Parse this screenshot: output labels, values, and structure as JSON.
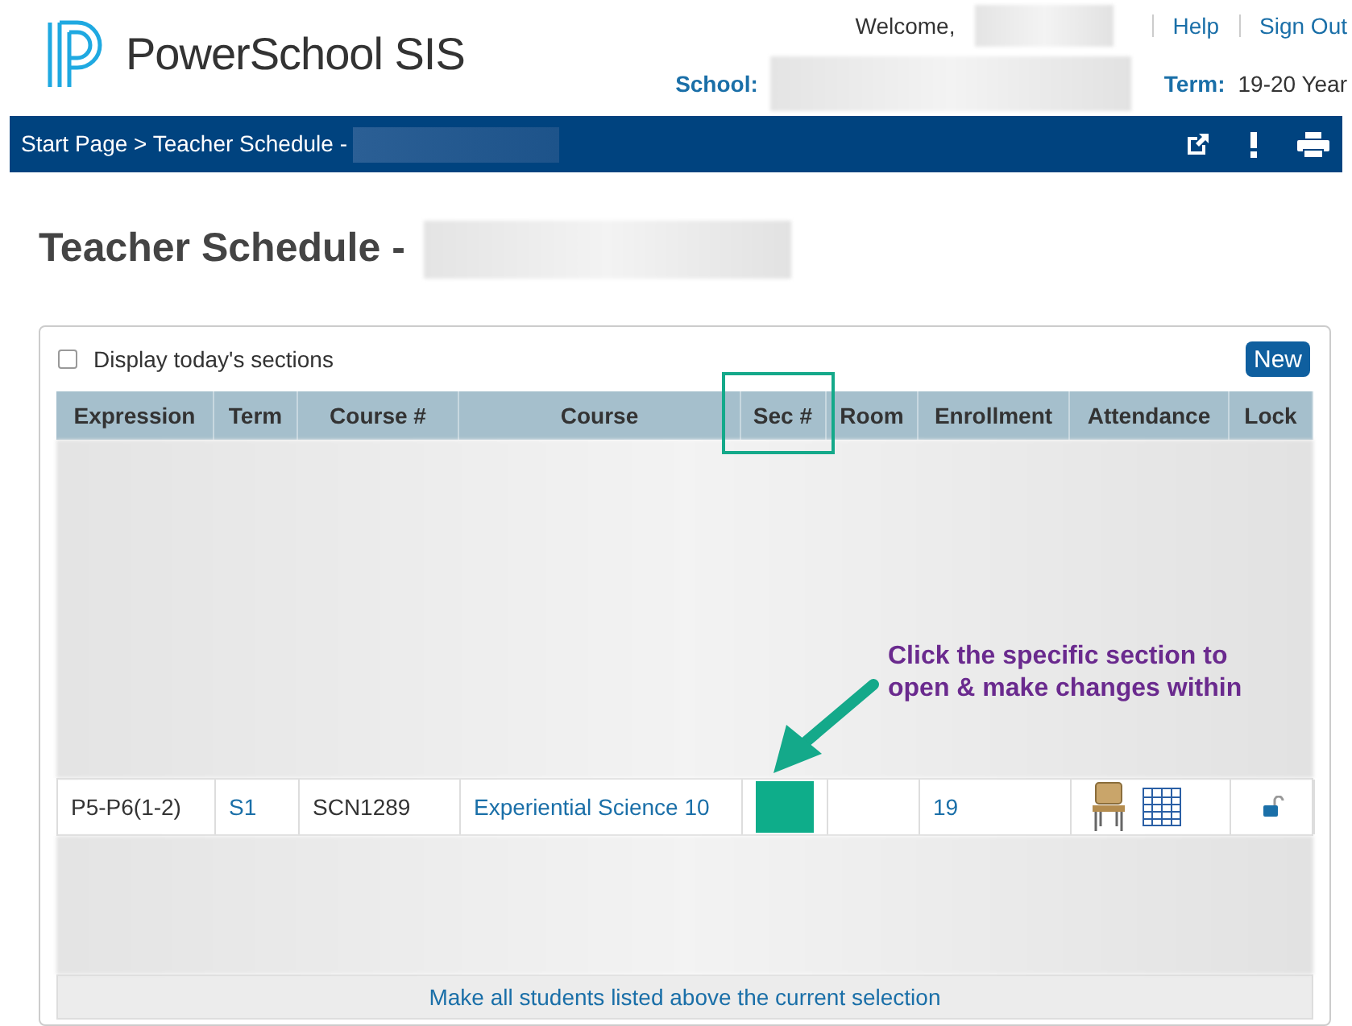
{
  "header": {
    "brand": "PowerSchool SIS",
    "welcome": "Welcome,",
    "links": [
      "Help",
      "Sign Out"
    ],
    "school_label": "School:",
    "term_label": "Term:",
    "term_value": "19-20 Year"
  },
  "nav_bar": {
    "breadcrumb": "Start Page > Teacher Schedule -"
  },
  "page_title": "Teacher Schedule -",
  "display_today": {
    "label": "Display today's sections",
    "checked": false
  },
  "new_button": "New",
  "table": {
    "columns": [
      "Expression",
      "Term",
      "Course #",
      "Course",
      "Sec #",
      "Room",
      "Enrollment",
      "Attendance",
      "Lock"
    ],
    "rows": [
      {
        "expression": "P5-P6(1-2)",
        "term": "S1",
        "course_number": "SCN1289",
        "course": "Experiential Science 10",
        "enrollment": "19"
      }
    ],
    "footer_link": "Make all students listed above the current selection"
  },
  "annotation": {
    "text": "Click the specific section to open & make changes within"
  }
}
